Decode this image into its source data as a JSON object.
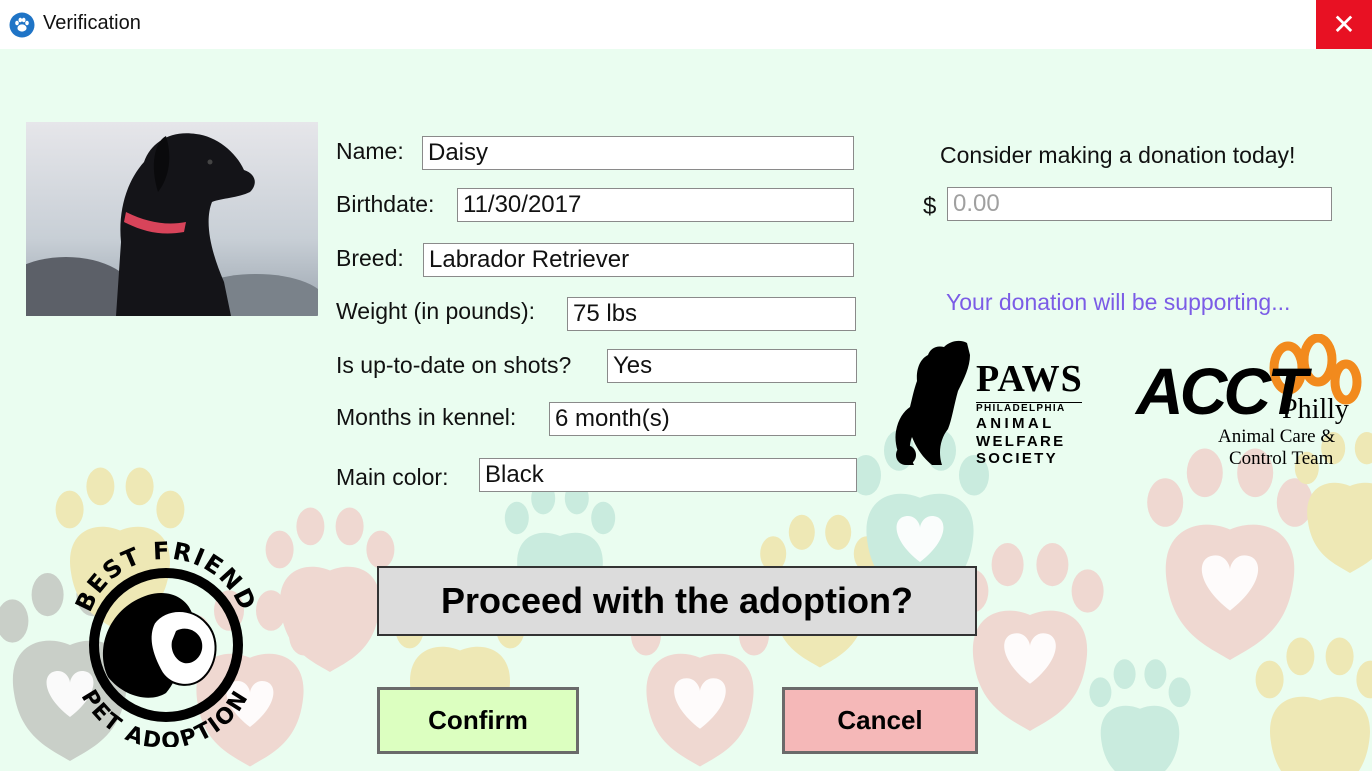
{
  "window": {
    "title": "Verification",
    "close_glyph": "✕"
  },
  "pet": {
    "fields": [
      {
        "label": "Name:",
        "value": "Daisy"
      },
      {
        "label": "Birthdate:",
        "value": "11/30/2017"
      },
      {
        "label": "Breed:",
        "value": "Labrador Retriever"
      },
      {
        "label": "Weight (in pounds):",
        "value": "75 lbs"
      },
      {
        "label": "Is up-to-date on shots?",
        "value": "Yes"
      },
      {
        "label": "Months in kennel:",
        "value": "6 month(s)"
      },
      {
        "label": "Main color:",
        "value": "Black"
      }
    ]
  },
  "donation": {
    "prompt": "Consider making a donation today!",
    "currency": "$",
    "placeholder": "0.00",
    "supporting_text": "Your donation will be supporting..."
  },
  "logos": {
    "paws": {
      "name": "PAWS",
      "line1": "PHILADELPHIA",
      "line2": "ANIMAL",
      "line3": "WELFARE",
      "line4": "SOCIETY"
    },
    "acct": {
      "name": "ACCT",
      "city": "Philly",
      "line1": "Animal Care &",
      "line2": "Control Team"
    },
    "best_friend": {
      "top": "BEST FRIEND",
      "bottom": "PET ADOPTION"
    }
  },
  "prompt": "Proceed with the adoption?",
  "buttons": {
    "confirm": "Confirm",
    "cancel": "Cancel"
  },
  "colors": {
    "background": "#eafdf0",
    "accent_purple": "#7b5ce6",
    "confirm_bg": "#dcffc0",
    "cancel_bg": "#f5b8b8",
    "close_red": "#e81123"
  }
}
